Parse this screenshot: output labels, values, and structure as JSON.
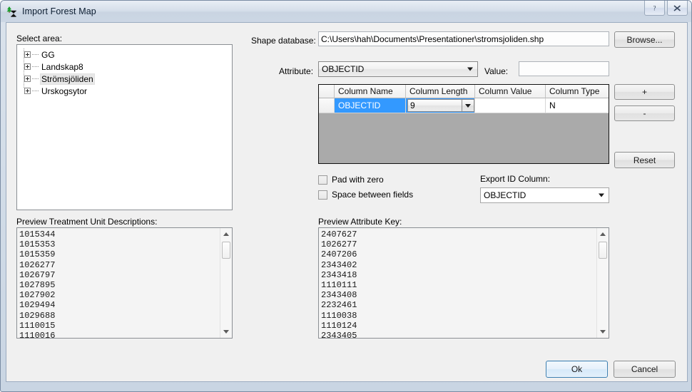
{
  "window": {
    "title": "Import Forest Map",
    "icon": "tree-hourglass-icon",
    "help_button": "?",
    "close_button": "✕"
  },
  "left": {
    "select_area_label": "Select area:",
    "tree_items": [
      {
        "label": "GG",
        "selected": false
      },
      {
        "label": "Landskap8",
        "selected": false
      },
      {
        "label": "Strömsjöliden",
        "selected": true
      },
      {
        "label": "Urskogsytor",
        "selected": false
      }
    ],
    "preview_label": "Preview Treatment Unit Descriptions:",
    "preview_items": [
      "1015344",
      "1015353",
      "1015359",
      "1026277",
      "1026797",
      "1027895",
      "1027902",
      "1029494",
      "1029688",
      "1110015",
      "1110016"
    ]
  },
  "right": {
    "shape_db_label": "Shape database:",
    "shape_db_value": "C:\\Users\\hah\\Documents\\Presentationer\\stromsjoliden.shp",
    "browse_label": "Browse...",
    "attribute_label": "Attribute:",
    "attribute_value": "OBJECTID",
    "value_label": "Value:",
    "value_value": "",
    "grid": {
      "headers": [
        "Column Name",
        "Column Length",
        "Column Value",
        "Column Type"
      ],
      "rows": [
        {
          "column_name": "OBJECTID",
          "column_length": "9",
          "column_value": "",
          "column_type": "N"
        }
      ]
    },
    "add_button": "+",
    "remove_button": "-",
    "reset_button": "Reset",
    "pad_with_zero_label": "Pad with zero",
    "pad_with_zero_checked": false,
    "space_between_fields_label": "Space between fields",
    "space_between_fields_checked": false,
    "export_id_label": "Export ID Column:",
    "export_id_value": "OBJECTID",
    "preview_label": "Preview Attribute Key:",
    "preview_items": [
      "2407627",
      "1026277",
      "2407206",
      "2343402",
      "2343418",
      "1110111",
      "2343408",
      "2232461",
      "1110038",
      "1110124",
      "2343405"
    ]
  },
  "footer": {
    "ok_label": "Ok",
    "cancel_label": "Cancel"
  },
  "colors": {
    "selection_blue": "#3399ff",
    "grid_background": "#aaaaaa",
    "default_button_border": "#3c7fb1",
    "client_background": "#f0f0f0"
  }
}
